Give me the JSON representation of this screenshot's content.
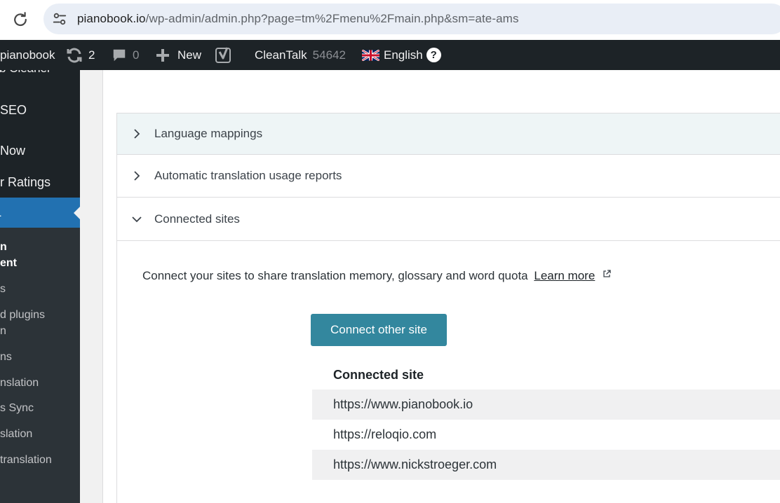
{
  "browser": {
    "url_host": "pianobook.io",
    "url_path": "/wp-admin/admin.php?page=tm%2Fmenu%2Fmain.php&sm=ate-ams"
  },
  "adminbar": {
    "site_name": "pianobook",
    "updates_count": "2",
    "comments_count": "0",
    "new_label": "New",
    "cleantalk_label": "CleanTalk",
    "cleantalk_count": "54642",
    "language_label": "English",
    "help_label": "?"
  },
  "sidebar": {
    "items": [
      {
        "label": "b Cleaner"
      },
      {
        "label": "SEO"
      },
      {
        "label": "Now"
      },
      {
        "label": "r Ratings"
      },
      {
        "label": "L"
      }
    ],
    "submenu": [
      {
        "label": "n"
      },
      {
        "label": "ent"
      },
      {
        "label": "s"
      },
      {
        "label": "d plugins"
      },
      {
        "label": "n"
      },
      {
        "label": "ns"
      },
      {
        "label": "nslation"
      },
      {
        "label": "s Sync"
      },
      {
        "label": "slation"
      },
      {
        "label": " translation"
      }
    ]
  },
  "accordions": [
    {
      "label": "Language mappings",
      "expanded": false
    },
    {
      "label": "Automatic translation usage reports",
      "expanded": false
    },
    {
      "label": "Connected sites",
      "expanded": true
    }
  ],
  "connected": {
    "description": "Connect your sites to share translation memory, glossary and word quota",
    "learn_more": "Learn more",
    "button_label": "Connect other site",
    "table_header": "Connected site",
    "sites": [
      "https://www.pianobook.io",
      "https://reloqio.com",
      "https://www.nickstroeger.com"
    ]
  },
  "colors": {
    "admin_bar": "#1d2327",
    "accent_button": "#33879e",
    "sidebar_current": "#2271b1"
  }
}
